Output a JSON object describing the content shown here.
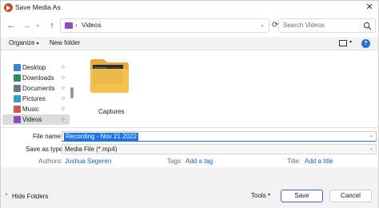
{
  "window": {
    "title": "Save Media As",
    "close_glyph": "✕",
    "app_icon": "media-player-icon"
  },
  "navigation": {
    "back_glyph": "←",
    "forward_glyph": "→",
    "recent_glyph": "⌄",
    "up_glyph": "↑",
    "address_separator": "›",
    "address_path": "Videos",
    "address_chevron": "⌄",
    "refresh_glyph": "⟳",
    "search_placeholder": "Search Videos"
  },
  "commandbar": {
    "organize_label": "Organize",
    "organize_chevron": "▾",
    "new_folder_label": "New folder",
    "view_chevron": "▾",
    "help_glyph": "?"
  },
  "sidebar": {
    "pin_glyph": "📌",
    "items": [
      {
        "label": "Desktop",
        "icon": "desktop-icon",
        "color": "#3a86d4",
        "selected": false
      },
      {
        "label": "Downloads",
        "icon": "downloads-icon",
        "color": "#2f8a5c",
        "selected": false
      },
      {
        "label": "Documents",
        "icon": "documents-icon",
        "color": "#6a7a8a",
        "selected": false
      },
      {
        "label": "Pictures",
        "icon": "pictures-icon",
        "color": "#3a9ad9",
        "selected": false
      },
      {
        "label": "Music",
        "icon": "music-icon",
        "color": "#d9534f",
        "selected": false
      },
      {
        "label": "Videos",
        "icon": "videos-icon",
        "color": "#8a4fbf",
        "selected": true
      }
    ]
  },
  "files": [
    {
      "name": "Captures",
      "type": "folder",
      "icon": "folder-icon"
    }
  ],
  "form": {
    "filename_label": "File name:",
    "filename_value": "Recording - Nov 21 2022",
    "savetype_label": "Save as type:",
    "savetype_value": "Media File (*.mp4)",
    "authors_label": "Authors:",
    "authors_value": "Joshua Segeren",
    "tags_label": "Tags:",
    "tags_value": "Add a tag",
    "title_label": "Title:",
    "title_value": "Add a title",
    "field_chevron": "⌄"
  },
  "footer": {
    "hide_chevron": "⌃",
    "hide_folders_label": "Hide Folders",
    "tools_label": "Tools",
    "tools_chevron": "▾",
    "save_label": "Save",
    "cancel_label": "Cancel"
  },
  "colors": {
    "accent": "#1a73e8",
    "link": "#1a5fb4",
    "folder": "#f5c24d"
  }
}
